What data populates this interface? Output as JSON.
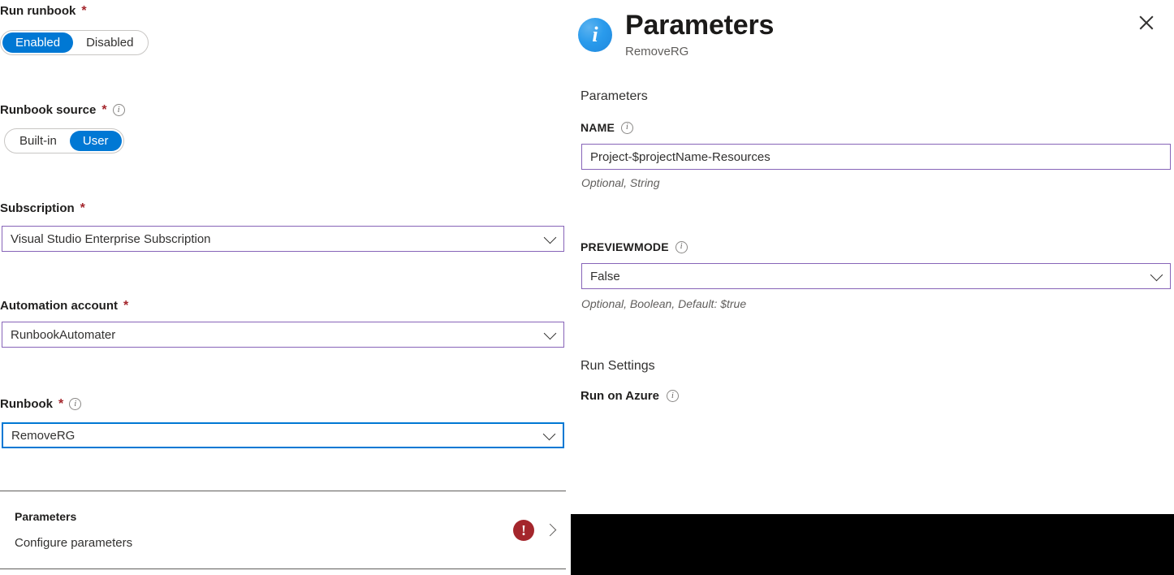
{
  "left_form": {
    "run_runbook": {
      "label": "Run runbook",
      "required_marker": "*",
      "options": [
        "Enabled",
        "Disabled"
      ],
      "selected": "Enabled"
    },
    "runbook_source": {
      "label": "Runbook source",
      "required_marker": "*",
      "info_icon": "info-icon",
      "options": [
        "Built-in",
        "User"
      ],
      "selected": "User"
    },
    "subscription": {
      "label": "Subscription",
      "required_marker": "*",
      "value": "Visual Studio Enterprise Subscription"
    },
    "automation_account": {
      "label": "Automation account",
      "required_marker": "*",
      "value": "RunbookAutomater"
    },
    "runbook": {
      "label": "Runbook",
      "required_marker": "*",
      "info_icon": "info-icon",
      "value": "RemoveRG"
    },
    "parameters_row": {
      "title": "Parameters",
      "subtitle": "Configure parameters",
      "error_icon": "error-exclamation-icon",
      "error_glyph": "!",
      "chevron_icon": "chevron-right-icon"
    }
  },
  "right_panel": {
    "header": {
      "info_icon": "info-circle-icon",
      "info_glyph": "i",
      "title": "Parameters",
      "subtitle": "RemoveRG",
      "close_icon": "close-icon"
    },
    "section_label": "Parameters",
    "fields": [
      {
        "name": "NAME",
        "info_icon": "info-icon",
        "kind": "textbox",
        "value": "Project-$projectName-Resources",
        "hint": "Optional, String"
      },
      {
        "name": "PREVIEWMODE",
        "info_icon": "info-icon",
        "kind": "dropdown",
        "value": "False",
        "hint": "Optional, Boolean, Default: $true"
      }
    ],
    "run_settings": {
      "section_label": "Run Settings",
      "run_on_label": "Run on Azure",
      "info_icon": "info-icon"
    }
  },
  "colors": {
    "accent_blue": "#0078d4",
    "field_purple": "#8764b8",
    "error_red": "#a4262c",
    "required_red": "#a4262c",
    "text_primary": "#323130",
    "text_secondary": "#605e5c"
  }
}
